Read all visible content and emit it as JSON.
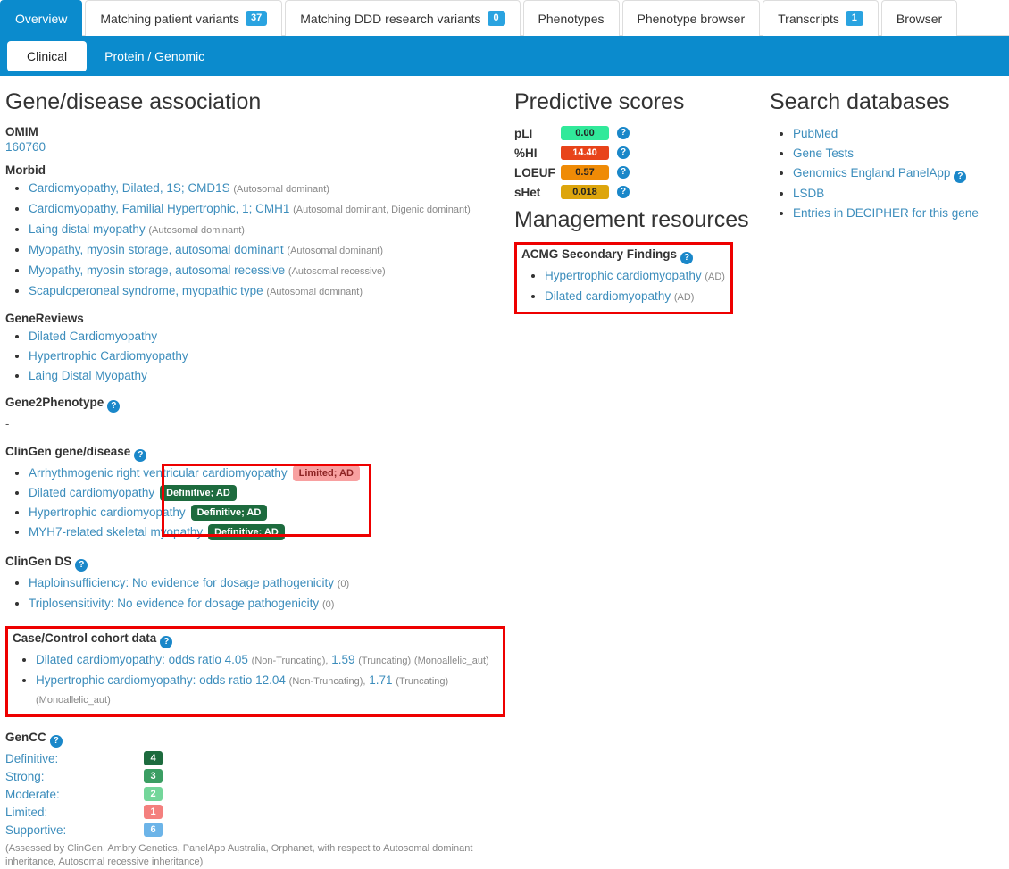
{
  "tabs": {
    "primary": [
      {
        "label": "Overview",
        "badge": null,
        "active": true
      },
      {
        "label": "Matching patient variants",
        "badge": "37",
        "active": false
      },
      {
        "label": "Matching DDD research variants",
        "badge": "0",
        "active": false
      },
      {
        "label": "Phenotypes",
        "badge": null,
        "active": false
      },
      {
        "label": "Phenotype browser",
        "badge": null,
        "active": false
      },
      {
        "label": "Transcripts",
        "badge": "1",
        "active": false
      },
      {
        "label": "Browser",
        "badge": null,
        "active": false
      }
    ],
    "secondary": [
      {
        "label": "Clinical",
        "active": true
      },
      {
        "label": "Protein / Genomic",
        "active": false
      }
    ]
  },
  "left": {
    "title": "Gene/disease association",
    "omim": {
      "heading": "OMIM",
      "value": "160760"
    },
    "morbid": {
      "heading": "Morbid",
      "items": [
        {
          "name": "Cardiomyopathy, Dilated, 1S; CMD1S",
          "note": "(Autosomal dominant)"
        },
        {
          "name": "Cardiomyopathy, Familial Hypertrophic, 1; CMH1",
          "note": "(Autosomal dominant, Digenic dominant)"
        },
        {
          "name": "Laing distal myopathy",
          "note": "(Autosomal dominant)"
        },
        {
          "name": "Myopathy, myosin storage, autosomal dominant",
          "note": "(Autosomal dominant)"
        },
        {
          "name": "Myopathy, myosin storage, autosomal recessive",
          "note": "(Autosomal recessive)"
        },
        {
          "name": "Scapuloperoneal syndrome, myopathic type",
          "note": "(Autosomal dominant)"
        }
      ]
    },
    "genereviews": {
      "heading": "GeneReviews",
      "items": [
        {
          "name": "Dilated Cardiomyopathy"
        },
        {
          "name": "Hypertrophic Cardiomyopathy"
        },
        {
          "name": "Laing Distal Myopathy"
        }
      ]
    },
    "gene2phenotype": {
      "heading": "Gene2Phenotype",
      "help": "?",
      "value": "-"
    },
    "clingen_gene_disease": {
      "heading": "ClinGen gene/disease",
      "help": "?",
      "items": [
        {
          "name": "Arrhythmogenic right ventricular cardiomyopathy",
          "tag": "Limited; AD",
          "tag_type": "limited"
        },
        {
          "name": "Dilated cardiomyopathy",
          "tag": "Definitive; AD",
          "tag_type": "definitive"
        },
        {
          "name": "Hypertrophic cardiomyopathy",
          "tag": "Definitive; AD",
          "tag_type": "definitive"
        },
        {
          "name": "MYH7-related skeletal myopathy",
          "tag": "Definitive; AD",
          "tag_type": "definitive"
        }
      ]
    },
    "clingen_ds": {
      "heading": "ClinGen DS",
      "help": "?",
      "items": [
        {
          "name": "Haploinsufficiency: No evidence for dosage pathogenicity",
          "note": "(0)"
        },
        {
          "name": "Triplosensitivity: No evidence for dosage pathogenicity",
          "note": "(0)"
        }
      ]
    },
    "case_control": {
      "heading": "Case/Control cohort data",
      "help": "?",
      "items": [
        {
          "name": "Dilated cardiomyopathy: odds ratio 4.05",
          "note1": "(Non-Truncating),",
          "value2": "1.59",
          "note2": "(Truncating)",
          "note3": "(Monoallelic_aut)"
        },
        {
          "name": "Hypertrophic cardiomyopathy: odds ratio 12.04",
          "note1": "(Non-Truncating),",
          "value2": "1.71",
          "note2": "(Truncating)",
          "note3": "(Monoallelic_aut)"
        }
      ]
    },
    "gencc": {
      "heading": "GenCC",
      "help": "?",
      "rows": [
        {
          "label": "Definitive:",
          "count": "4",
          "color": "#1d6b3e"
        },
        {
          "label": "Strong:",
          "count": "3",
          "color": "#3b9e63"
        },
        {
          "label": "Moderate:",
          "count": "2",
          "color": "#74d69a"
        },
        {
          "label": "Limited:",
          "count": "1",
          "color": "#f4807e"
        },
        {
          "label": "Supportive:",
          "count": "6",
          "color": "#6cb4e8"
        }
      ],
      "note": "(Assessed by ClinGen, Ambry Genetics, PanelApp Australia, Orphanet, with respect to Autosomal dominant inheritance, Autosomal recessive inheritance)"
    }
  },
  "middle": {
    "predictive_title": "Predictive scores",
    "scores": [
      {
        "label": "pLI",
        "value": "0.00",
        "bg": "#31e99a",
        "fg": "#222222"
      },
      {
        "label": "%HI",
        "value": "14.40",
        "bg": "#e8441a",
        "fg": "#ffffff"
      },
      {
        "label": "LOEUF",
        "value": "0.57",
        "bg": "#ef8b06",
        "fg": "#222222"
      },
      {
        "label": "sHet",
        "value": "0.018",
        "bg": "#dda50d",
        "fg": "#222222"
      }
    ],
    "management_title": "Management resources",
    "acmg": {
      "heading": "ACMG Secondary Findings",
      "help": "?",
      "items": [
        {
          "name": "Hypertrophic cardiomyopathy",
          "note": "(AD)"
        },
        {
          "name": "Dilated cardiomyopathy",
          "note": "(AD)"
        }
      ]
    }
  },
  "right": {
    "title": "Search databases",
    "items": [
      {
        "name": "PubMed",
        "help": false
      },
      {
        "name": "Gene Tests",
        "help": false
      },
      {
        "name": "Genomics England PanelApp",
        "help": true
      },
      {
        "name": "LSDB",
        "help": false
      },
      {
        "name": "Entries in DECIPHER for this gene",
        "help": false
      }
    ]
  },
  "icons": {
    "help": "?"
  }
}
